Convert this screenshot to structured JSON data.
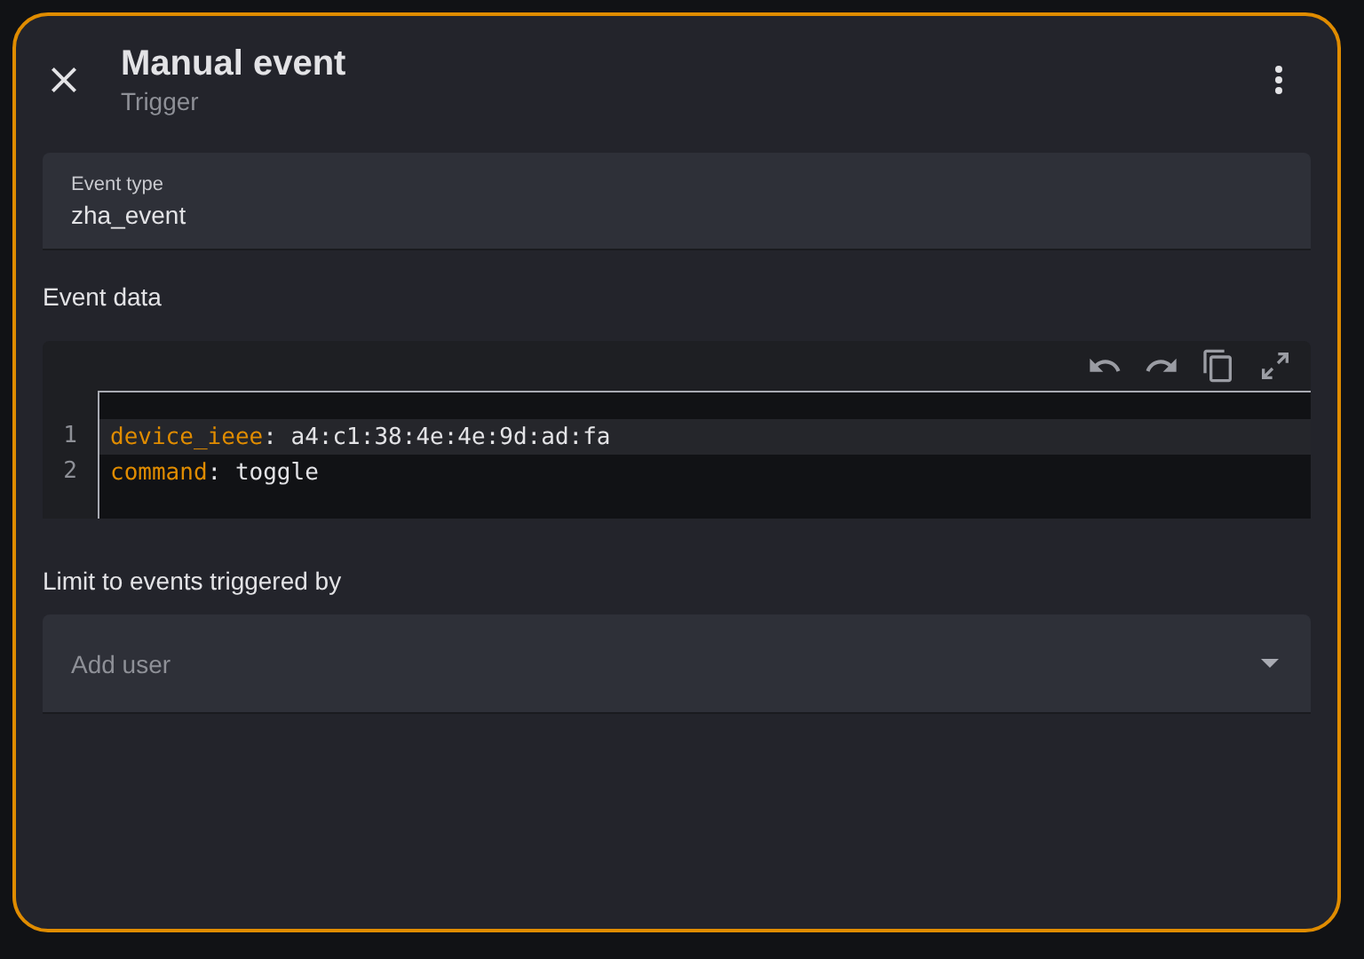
{
  "dialog": {
    "title": "Manual event",
    "subtitle": "Trigger"
  },
  "event_type": {
    "label": "Event type",
    "value": "zha_event"
  },
  "event_data": {
    "label": "Event data",
    "lines": [
      {
        "number": "1",
        "key": "device_ieee",
        "separator": ":",
        "value": " a4:c1:38:4e:4e:9d:ad:fa",
        "active": true
      },
      {
        "number": "2",
        "key": "command",
        "separator": ":",
        "value": " toggle",
        "active": false
      }
    ]
  },
  "limit": {
    "label": "Limit to events triggered by",
    "placeholder": "Add user"
  }
}
